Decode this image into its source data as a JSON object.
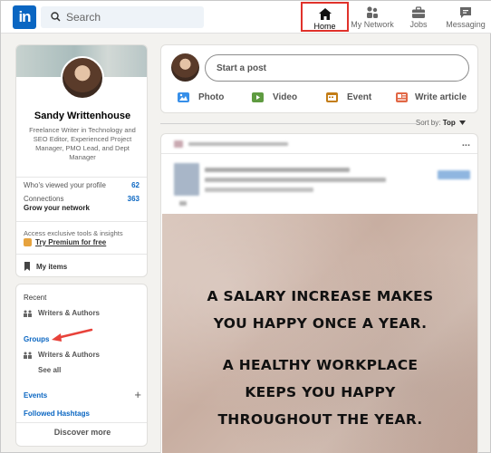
{
  "nav": {
    "logo": "in",
    "search_placeholder": "Search",
    "items": [
      {
        "label": "Home",
        "icon": "home-icon",
        "active": true
      },
      {
        "label": "My Network",
        "icon": "network-icon"
      },
      {
        "label": "Jobs",
        "icon": "briefcase-icon"
      },
      {
        "label": "Messaging",
        "icon": "messaging-icon"
      }
    ]
  },
  "profile": {
    "name": "Sandy Writtenhouse",
    "headline": "Freelance Writer in Technology and SEO Editor, Experienced Project Manager, PMO Lead, and Dept Manager",
    "viewed_label": "Who's viewed your profile",
    "viewed_count": "62",
    "connections_label": "Connections",
    "connections_count": "363",
    "grow_label": "Grow your network",
    "access_text": "Access exclusive tools & insights",
    "premium_label": "Try Premium for free",
    "my_items": "My items"
  },
  "left_nav": {
    "recent_label": "Recent",
    "recent_item": "Writers & Authors",
    "groups_label": "Groups",
    "groups_item": "Writers & Authors",
    "see_all": "See all",
    "events_label": "Events",
    "hashtags_label": "Followed Hashtags",
    "discover_label": "Discover more",
    "add_symbol": "+"
  },
  "share_box": {
    "start_post": "Start a post",
    "actions": [
      {
        "label": "Photo",
        "icon": "photo-icon",
        "color": "#378fe9"
      },
      {
        "label": "Video",
        "icon": "video-icon",
        "color": "#5f9b41"
      },
      {
        "label": "Event",
        "icon": "event-icon",
        "color": "#c37d16"
      },
      {
        "label": "Write article",
        "icon": "article-icon",
        "color": "#e16745"
      }
    ]
  },
  "feed": {
    "sort_label": "Sort by:",
    "sort_value": "Top",
    "post_lines": [
      "A SALARY INCREASE MAKES",
      "YOU HAPPY ONCE A YEAR.",
      "",
      "A HEALTHY WORKPLACE",
      "KEEPS YOU HAPPY",
      "THROUGHOUT THE YEAR."
    ],
    "more": "..."
  },
  "colors": {
    "brand": "#0a66c2",
    "highlight": "#e0322b",
    "background": "#f3f2ef"
  }
}
